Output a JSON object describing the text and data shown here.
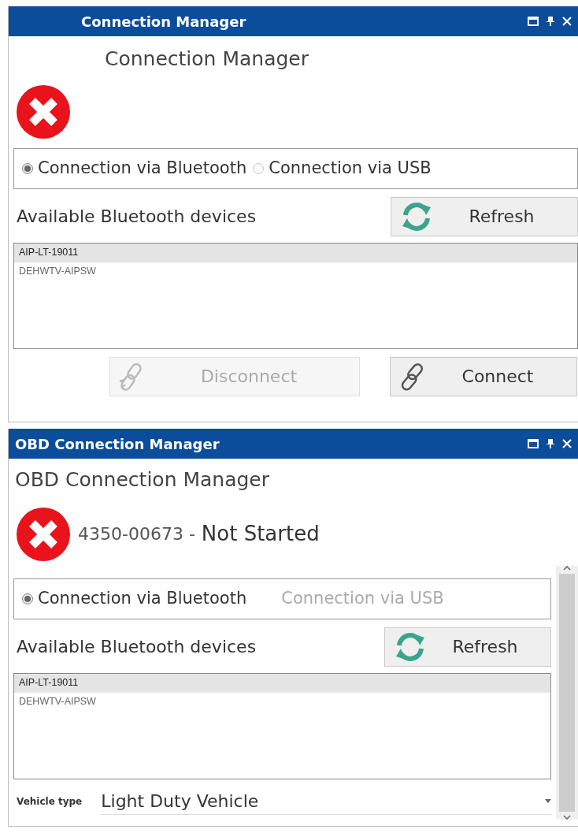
{
  "panels": [
    {
      "title": "Connection Manager",
      "heading": "Connection Manager",
      "status": {
        "kind": "error"
      },
      "scrollable": false,
      "connection_options": [
        {
          "label": "Connection via Bluetooth",
          "selected": true,
          "disabled": false
        },
        {
          "label": "Connection via USB",
          "selected": false,
          "disabled": false
        }
      ],
      "devices_label": "Available Bluetooth devices",
      "refresh_button": "Refresh",
      "devices": [
        {
          "name": "AIP-LT-19011",
          "selected": true
        },
        {
          "name": "DEHWTV-AIPSW",
          "selected": false
        }
      ],
      "buttons": [
        {
          "kind": "disconnect",
          "label": "Disconnect",
          "disabled": true
        },
        {
          "kind": "connect",
          "label": "Connect",
          "disabled": false
        }
      ]
    },
    {
      "title": "OBD Connection Manager",
      "heading": "OBD Connection Manager",
      "status": {
        "kind": "error",
        "serial": "4350-00673 -",
        "state": "Not Started"
      },
      "scrollable": true,
      "connection_options": [
        {
          "label": "Connection via Bluetooth",
          "selected": true,
          "disabled": false
        },
        {
          "label": "Connection via USB",
          "selected": false,
          "disabled": true
        }
      ],
      "devices_label": "Available Bluetooth devices",
      "refresh_button": "Refresh",
      "devices": [
        {
          "name": "AIP-LT-19011",
          "selected": true
        },
        {
          "name": "DEHWTV-AIPSW",
          "selected": false
        }
      ],
      "vehicle_type": {
        "label": "Vehicle type",
        "value": "Light Duty Vehicle"
      }
    }
  ]
}
